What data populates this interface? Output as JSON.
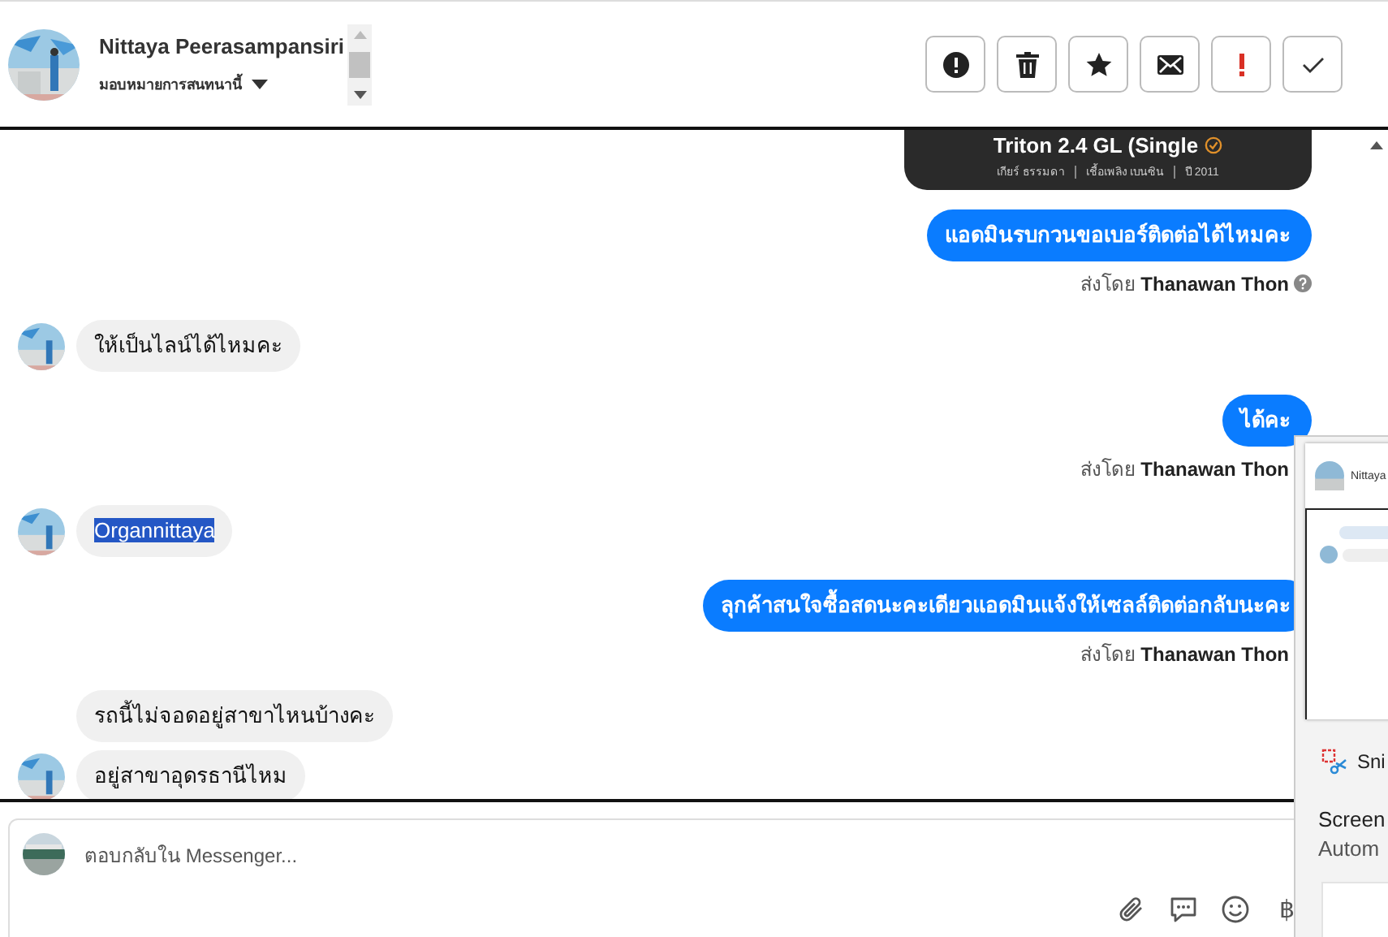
{
  "header": {
    "contact_name": "Nittaya Peerasampansiri",
    "assign_label": "มอบหมายการสนทนานี้",
    "actions": [
      {
        "kind": "alert"
      },
      {
        "kind": "trash"
      },
      {
        "kind": "star"
      },
      {
        "kind": "mail"
      },
      {
        "kind": "urgent"
      },
      {
        "kind": "check"
      }
    ]
  },
  "messages": [
    {
      "kind": "card",
      "title": "Triton 2.4 GL (Single",
      "specs": [
        "เกียร์ ธรรมดา",
        "เชื้อเพลิง เบนซิน",
        "ปี 2011"
      ]
    },
    {
      "kind": "outgoing",
      "text": "แอดมินรบกวนขอเบอร์ติดต่อได้ไหมคะ",
      "sent_by_label": "ส่งโดย",
      "sender": "Thanawan Thon",
      "info_icon": true
    },
    {
      "kind": "incoming",
      "text": "ให้เป็นไลน์ได้ไหมคะ",
      "avatar": true,
      "highlighted": false
    },
    {
      "kind": "outgoing",
      "text": "ได้คะ",
      "sent_by_label": "ส่งโดย",
      "sender": "Thanawan Thon",
      "info_icon": false
    },
    {
      "kind": "incoming",
      "text": "Organnittaya",
      "avatar": true,
      "highlighted": true
    },
    {
      "kind": "outgoing",
      "text": "ลุกค้าสนใจซื้อสดนะคะเดียวแอดมินแจ้งให้เซลล์ติดต่อกลับนะคะ",
      "sent_by_label": "ส่งโดย",
      "sender": "Thanawan Thon",
      "info_icon": false
    },
    {
      "kind": "incoming",
      "text": "รถนี้ไม่จอดอยู่สาขาไหนบ้างคะ",
      "avatar": false,
      "highlighted": false
    },
    {
      "kind": "incoming",
      "text": "อยู่สาขาอุดรธานีไหม",
      "avatar": true,
      "highlighted": false
    }
  ],
  "composer": {
    "placeholder": "ตอบกลับใน Messenger...",
    "tools": [
      {
        "kind": "attach"
      },
      {
        "kind": "chat"
      },
      {
        "kind": "emoji"
      },
      {
        "kind": "text",
        "label": "฿"
      }
    ]
  },
  "snip_toast": {
    "thumbnail_name": "Nittaya",
    "app_name": "Sni",
    "title": "Screen",
    "subtitle": "Autom"
  }
}
